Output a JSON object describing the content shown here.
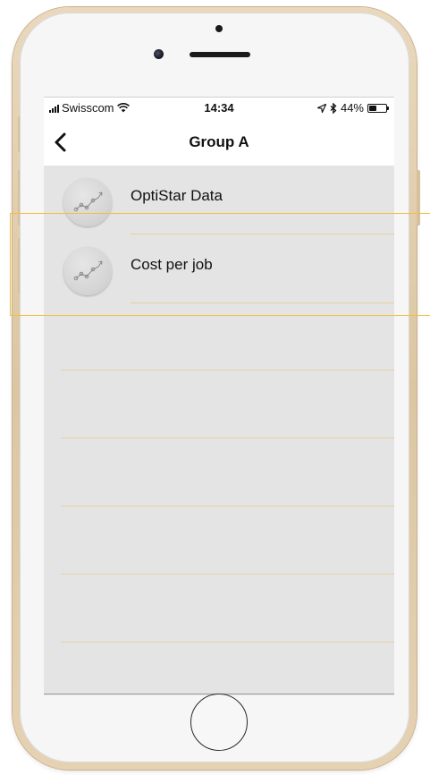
{
  "status_bar": {
    "carrier": "Swisscom",
    "time": "14:34",
    "battery_text": "44%",
    "battery_level": 0.44
  },
  "nav": {
    "title": "Group A",
    "back_icon": "chevron-left-icon"
  },
  "list": {
    "items": [
      {
        "label": "OptiStar Data",
        "icon": "trend-chart-icon"
      },
      {
        "label": "Cost per job",
        "icon": "trend-chart-icon"
      }
    ],
    "highlighted_index": 1
  },
  "colors": {
    "separator": "#e9cfa0",
    "highlight": "#f0c040",
    "list_background": "#e4e4e4"
  }
}
